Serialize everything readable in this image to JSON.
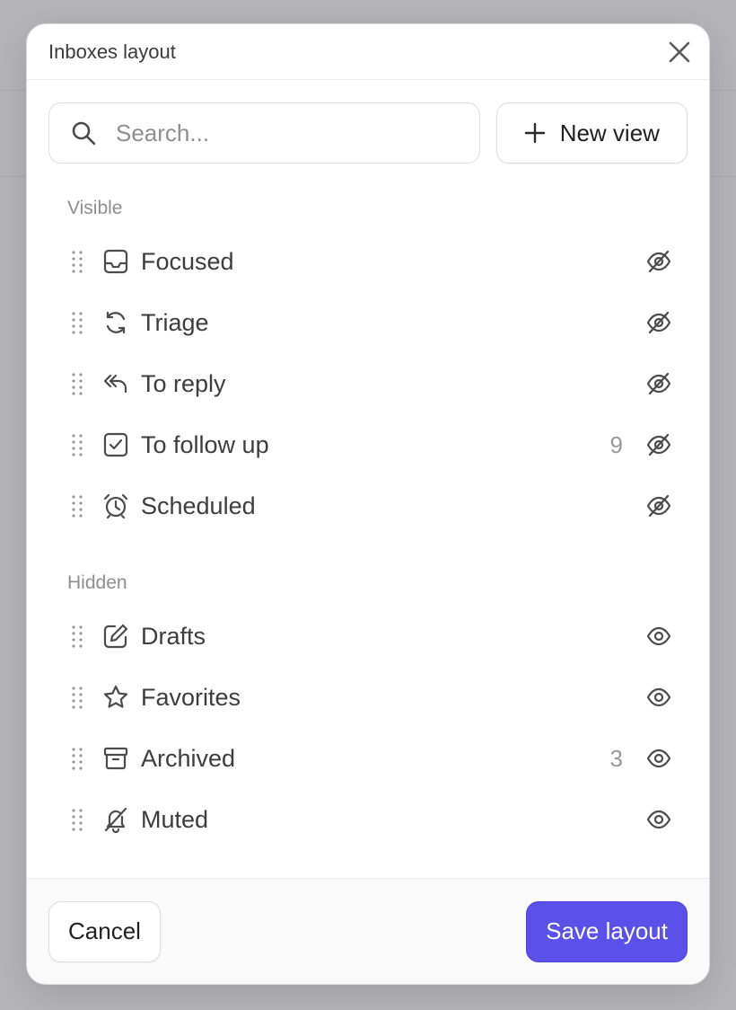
{
  "modal": {
    "title": "Inboxes layout",
    "search_placeholder": "Search...",
    "new_view_label": "New view"
  },
  "sections": {
    "visible_label": "Visible",
    "hidden_label": "Hidden"
  },
  "visible_items": [
    {
      "label": "Focused",
      "icon": "inbox-icon",
      "count": ""
    },
    {
      "label": "Triage",
      "icon": "refresh-icon",
      "count": ""
    },
    {
      "label": "To reply",
      "icon": "reply-icon",
      "count": ""
    },
    {
      "label": "To follow up",
      "icon": "checkbox-icon",
      "count": "9"
    },
    {
      "label": "Scheduled",
      "icon": "alarm-clock-icon",
      "count": ""
    }
  ],
  "hidden_items": [
    {
      "label": "Drafts",
      "icon": "edit-icon",
      "count": ""
    },
    {
      "label": "Favorites",
      "icon": "star-icon",
      "count": ""
    },
    {
      "label": "Archived",
      "icon": "archive-icon",
      "count": "3"
    },
    {
      "label": "Muted",
      "icon": "bell-off-icon",
      "count": ""
    }
  ],
  "footer": {
    "cancel_label": "Cancel",
    "save_label": "Save layout"
  },
  "colors": {
    "accent": "#5b50ea",
    "text": "#3c3c41",
    "muted": "#8e8e93"
  }
}
